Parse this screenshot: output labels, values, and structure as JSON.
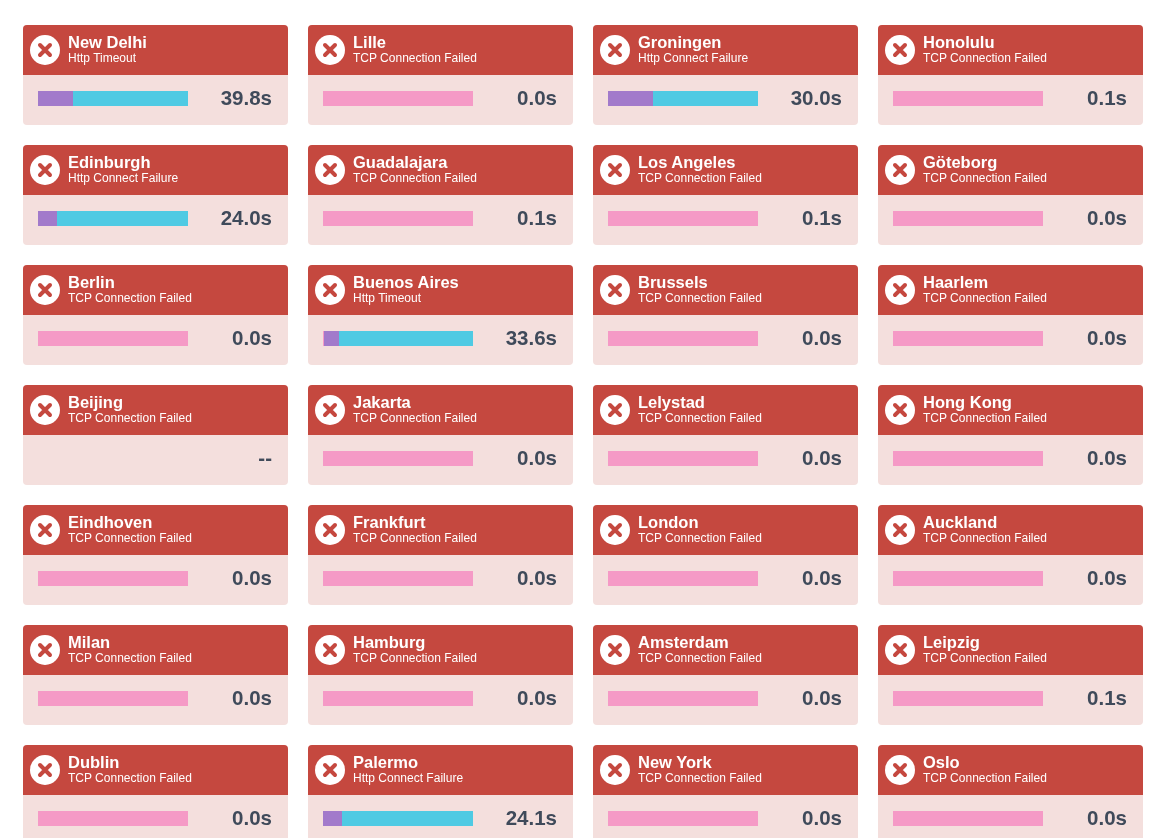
{
  "monitors": [
    {
      "location": "New Delhi",
      "error": "Http Timeout",
      "timing_bar": true,
      "timing": [
        {
          "color": "#a27acb",
          "level": 0.233
        },
        {
          "color": "#4fcae3",
          "level": 0.767
        }
      ],
      "duration": "39.8s"
    },
    {
      "location": "Lille",
      "error": "TCP Connection Failed",
      "timing_bar": true,
      "duration": "0.0s"
    },
    {
      "location": "Groningen",
      "error": "Http Connect Failure",
      "timing_bar": true,
      "timing": [
        {
          "color": "#a27acb",
          "level": 0.3
        },
        {
          "color": "#4fcae3",
          "level": 0.7
        }
      ],
      "duration": "30.0s"
    },
    {
      "location": "Honolulu",
      "error": "TCP Connection Failed",
      "timing_bar": true,
      "duration": "0.1s"
    },
    {
      "location": "Edinburgh",
      "error": "Http Connect Failure",
      "timing_bar": true,
      "timing": [
        {
          "color": "#a27acb",
          "level": 0.127
        },
        {
          "color": "#4fcae3",
          "level": 0.873
        }
      ],
      "duration": "24.0s"
    },
    {
      "location": "Guadalajara",
      "error": "TCP Connection Failed",
      "timing_bar": true,
      "duration": "0.1s"
    },
    {
      "location": "Los Angeles",
      "error": "TCP Connection Failed",
      "timing_bar": true,
      "duration": "0.1s"
    },
    {
      "location": "Göteborg",
      "error": "TCP Connection Failed",
      "timing_bar": true,
      "duration": "0.0s"
    },
    {
      "location": "Berlin",
      "error": "TCP Connection Failed",
      "timing_bar": true,
      "duration": "0.0s"
    },
    {
      "location": "Buenos Aires",
      "error": "Http Timeout",
      "timing_bar": true,
      "timing": [
        {
          "color": "#a27acb",
          "level": 0.1
        },
        {
          "color": "#4fcae3",
          "level": 0.893
        }
      ],
      "duration": "33.6s"
    },
    {
      "location": "Brussels",
      "error": "TCP Connection Failed",
      "timing_bar": true,
      "duration": "0.0s"
    },
    {
      "location": "Haarlem",
      "error": "TCP Connection Failed",
      "timing_bar": true,
      "duration": "0.0s"
    },
    {
      "location": "Beijing",
      "error": "TCP Connection Failed",
      "timing_bar": false,
      "duration": "--"
    },
    {
      "location": "Jakarta",
      "error": "TCP Connection Failed",
      "timing_bar": true,
      "duration": "0.0s"
    },
    {
      "location": "Lelystad",
      "error": "TCP Connection Failed",
      "timing_bar": true,
      "duration": "0.0s"
    },
    {
      "location": "Hong Kong",
      "error": "TCP Connection Failed",
      "timing_bar": true,
      "duration": "0.0s"
    },
    {
      "location": "Eindhoven",
      "error": "TCP Connection Failed",
      "timing_bar": true,
      "duration": "0.0s"
    },
    {
      "location": "Frankfurt",
      "error": "TCP Connection Failed",
      "timing_bar": true,
      "duration": "0.0s"
    },
    {
      "location": "London",
      "error": "TCP Connection Failed",
      "timing_bar": true,
      "duration": "0.0s"
    },
    {
      "location": "Auckland",
      "error": "TCP Connection Failed",
      "timing_bar": true,
      "duration": "0.0s"
    },
    {
      "location": "Milan",
      "error": "TCP Connection Failed",
      "timing_bar": true,
      "duration": "0.0s"
    },
    {
      "location": "Hamburg",
      "error": "TCP Connection Failed",
      "timing_bar": true,
      "duration": "0.0s"
    },
    {
      "location": "Amsterdam",
      "error": "TCP Connection Failed",
      "timing_bar": true,
      "duration": "0.0s"
    },
    {
      "location": "Leipzig",
      "error": "TCP Connection Failed",
      "timing_bar": true,
      "duration": "0.1s"
    },
    {
      "location": "Dublin",
      "error": "TCP Connection Failed",
      "timing_bar": true,
      "duration": "0.0s"
    },
    {
      "location": "Palermo",
      "error": "Http Connect Failure",
      "timing_bar": true,
      "timing": [
        {
          "color": "#a27acb",
          "level": 0.127
        },
        {
          "color": "#4fcae3",
          "level": 0.873
        }
      ],
      "duration": "24.1s"
    },
    {
      "location": "New York",
      "error": "TCP Connection Failed",
      "timing_bar": true,
      "duration": "0.0s"
    },
    {
      "location": "Oslo",
      "error": "TCP Connection Failed",
      "timing_bar": true,
      "duration": "0.0s"
    }
  ]
}
